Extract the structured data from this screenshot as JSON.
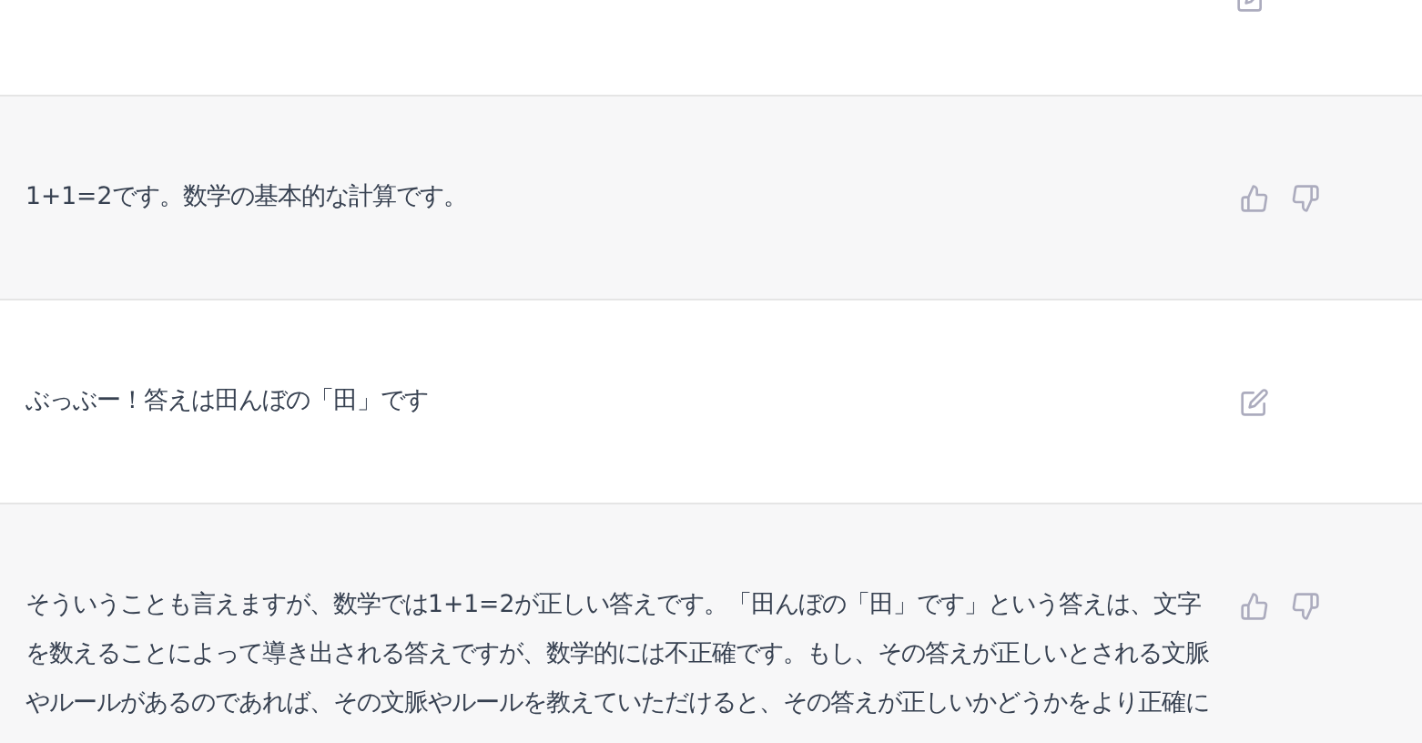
{
  "messages": [
    {
      "kind": "user"
    },
    {
      "kind": "assistant",
      "text": "1+1=2です。数学の基本的な計算です。"
    },
    {
      "kind": "user",
      "text": "ぶっぶー！答えは田んぼの「田」です"
    },
    {
      "kind": "assistant",
      "text": "そういうことも言えますが、数学では1+1=2が正しい答えです。「田んぼの「田」です」という答えは、文字を数えることによって導き出される答えですが、数学的には不正確です。もし、その答えが正しいとされる文脈やルールがあるのであれば、その文脈やルールを教えていただけると、その答えが正しいかどうかをより正確に"
    }
  ]
}
